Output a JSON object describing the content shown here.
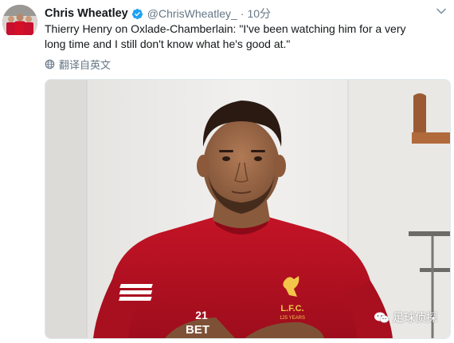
{
  "tweet": {
    "display_name": "Chris Wheatley",
    "handle": "@ChrisWheatley_",
    "separator": "·",
    "time": "10分",
    "text": "Thierry Henry on Oxlade-Chamberlain: \"I've been watching him for a very long time and I still don't know what he's good at.\"",
    "translate_label": "翻译自英文"
  },
  "media": {
    "shirt_number": "21",
    "crest_text": "L.F.C.",
    "crest_subtext": "125 YEARS",
    "watermark": "足球侦探"
  },
  "icons": {
    "verified": "verified-badge-icon",
    "caret": "chevron-down-icon",
    "translate": "globe-icon",
    "watermark_logo": "wechat-icon"
  },
  "colors": {
    "name": "#14171a",
    "secondary_text": "#657786",
    "verified_blue": "#1da1f2",
    "liverpool_red": "#b5101e"
  }
}
